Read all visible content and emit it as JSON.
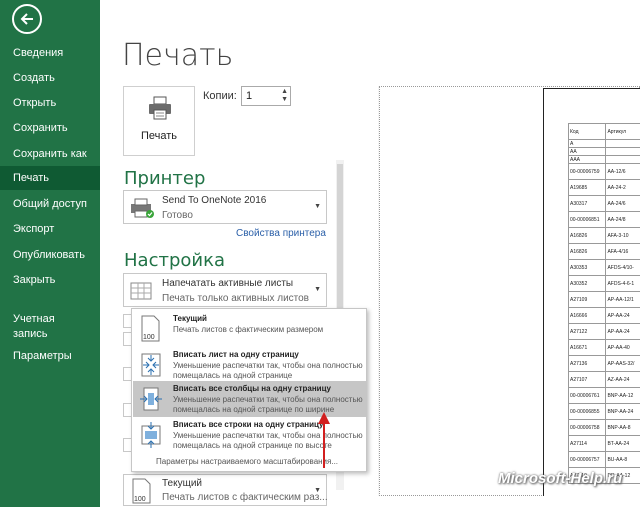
{
  "sidebar": {
    "items": [
      {
        "label": "Сведения"
      },
      {
        "label": "Создать"
      },
      {
        "label": "Открыть"
      },
      {
        "label": "Сохранить"
      },
      {
        "label": "Сохранить как"
      },
      {
        "label": "Печать"
      },
      {
        "label": "Общий доступ"
      },
      {
        "label": "Экспорт"
      },
      {
        "label": "Опубликовать"
      },
      {
        "label": "Закрыть"
      },
      {
        "label": "Учетная запись"
      },
      {
        "label": "Параметры"
      }
    ],
    "active": "Печать",
    "color": "#217346"
  },
  "main": {
    "title": "Печать",
    "print_button": "Печать",
    "copies_label": "Копии:",
    "copies_value": "1"
  },
  "printer": {
    "heading": "Принтер",
    "name": "Send To OneNote 2016",
    "status": "Готово",
    "properties_link": "Свойства принтера"
  },
  "settings": {
    "heading": "Настройка",
    "print_what": {
      "title": "Напечатать активные листы",
      "desc": "Печать только активных листов"
    },
    "scaling": {
      "title": "Текущий",
      "desc": "Печать листов с фактическим раз..."
    }
  },
  "scaling_menu": {
    "options": [
      {
        "title": "Текущий",
        "desc": "Печать листов с фактическим размером"
      },
      {
        "title": "Вписать лист на одну страницу",
        "desc": "Уменьшение распечатки так, чтобы она полностью помещалась на одной странице"
      },
      {
        "title": "Вписать все столбцы на одну страницу",
        "desc": "Уменьшение распечатки так, чтобы она полностью помещалась на одной странице по ширине"
      },
      {
        "title": "Вписать все строки на одну страницу",
        "desc": "Уменьшение распечатки так, чтобы она полностью помещалась на одной странице по высоте"
      }
    ],
    "highlighted_index": 2,
    "footer": "Параметры настраиваемого масштабирования..."
  },
  "preview": {
    "header_cols": [
      "Код",
      "Артикул"
    ],
    "rows": [
      [
        "А",
        ""
      ],
      [
        "АА",
        ""
      ],
      [
        "ААА",
        ""
      ],
      [
        "00-00006759",
        "AA-12/6"
      ],
      [
        "A19685",
        "AA-24-2"
      ],
      [
        "A30317",
        "AA-24/6"
      ],
      [
        "00-00006851",
        "AA-24/8"
      ],
      [
        "A16826",
        "AFA-3-10"
      ],
      [
        "A16826",
        "AFA-4/16"
      ],
      [
        "A30353",
        "AFDS-4/10-"
      ],
      [
        "A30352",
        "AFDS-4-6-1"
      ],
      [
        "A27109",
        "AP-AA-12/1"
      ],
      [
        "A16666",
        "AP-AA-24"
      ],
      [
        "A27122",
        "AP-AA-24"
      ],
      [
        "A16671",
        "AP-AA-40"
      ],
      [
        "A27136",
        "AP-AAS-32/"
      ],
      [
        "A27107",
        "AZ-AA-24"
      ],
      [
        "00-00006761",
        "BNP-AA-12"
      ],
      [
        "00-00006855",
        "BNP-AA-24"
      ],
      [
        "00-00006758",
        "BNP-AA-8"
      ],
      [
        "A27114",
        "BT-AA-24"
      ],
      [
        "00-00006757",
        "BU-AA-8"
      ],
      [
        "A27110",
        "DR-AA-12"
      ]
    ],
    "watermark": "Microsoft-Help.ru"
  }
}
